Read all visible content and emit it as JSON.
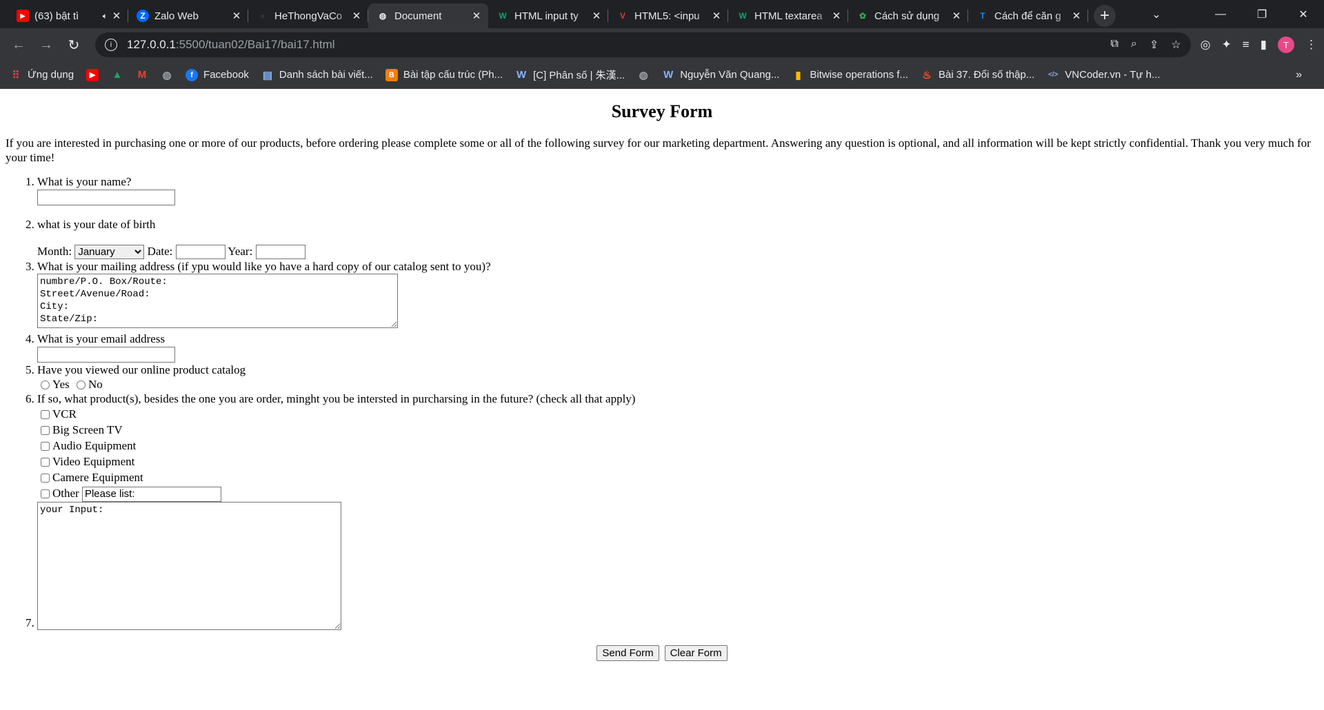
{
  "browser": {
    "tabs": [
      {
        "title": "(63) bật tì",
        "favicon": "youtube-icon",
        "color": "#ff0000",
        "audio": true,
        "active": false
      },
      {
        "title": "Zalo Web",
        "favicon": "zalo-icon",
        "color": "#0068ff",
        "active": false
      },
      {
        "title": "HeThongVaCo",
        "favicon": "github-icon",
        "color": "#333333",
        "active": false
      },
      {
        "title": "Document",
        "favicon": "globe-icon",
        "color": "#e8eaed",
        "active": true
      },
      {
        "title": "HTML input ty",
        "favicon": "w3schools-icon",
        "color": "#04aa6d",
        "active": false
      },
      {
        "title": "HTML5: <inpu",
        "favicon": "v1-icon",
        "color": "#e53935",
        "active": false
      },
      {
        "title": "HTML textarea",
        "favicon": "w3schools-icon",
        "color": "#04aa6d",
        "active": false
      },
      {
        "title": "Cách sử dụng",
        "favicon": "green-gear-icon",
        "color": "#34a853",
        "active": false
      },
      {
        "title": "Cách để căn g",
        "favicon": "blue-t-icon",
        "color": "#1e88e5",
        "active": false
      }
    ],
    "url_host": "127.0.0.1",
    "url_path": ":5500/tuan02/Bai17/bai17.html",
    "profile_initial": "T",
    "bookmarks": [
      {
        "label": "Ứng dụng",
        "icon": "apps-grid-icon",
        "color": "#e8453c"
      },
      {
        "label": "",
        "icon": "youtube-icon",
        "color": "#ff0000"
      },
      {
        "label": "",
        "icon": "drive-icon",
        "color": "#1fa463"
      },
      {
        "label": "",
        "icon": "gmail-icon",
        "color": "#ea4335"
      },
      {
        "label": "",
        "icon": "globe-icon",
        "color": "#9aa0a6"
      },
      {
        "label": "Facebook",
        "icon": "facebook-icon",
        "color": "#1877f2"
      },
      {
        "label": "Danh sách bài viết...",
        "icon": "document-icon",
        "color": "#8ab4f8"
      },
      {
        "label": "Bài tập cấu trúc (Ph...",
        "icon": "blogger-icon",
        "color": "#f57d00"
      },
      {
        "label": "[C] Phân số | 朱漢...",
        "icon": "wordpress-icon",
        "color": "#8ab4f8"
      },
      {
        "label": "",
        "icon": "globe-icon",
        "color": "#9aa0a6"
      },
      {
        "label": "Nguyễn Văn Quang...",
        "icon": "wordpress-icon",
        "color": "#8ab4f8"
      },
      {
        "label": "Bitwise operations f...",
        "icon": "bar-chart-icon",
        "color": "#fbbc04"
      },
      {
        "label": "Bài 37. Đổi số thập...",
        "icon": "fire-icon",
        "color": "#ff5722"
      },
      {
        "label": "VNCoder.vn - Tự h...",
        "icon": "code-icon",
        "color": "#8ab4f8"
      }
    ]
  },
  "page": {
    "title": "Survey Form",
    "intro": "If you are interested in purchasing one or more of our products, before ordering please complete some or all of the following survey for our marketing department. Answering any question is optional, and all information will be kept strictly confidential. Thank you very much for your time!",
    "q1": "What is your name?",
    "q2": "what is your date of birth",
    "month_label": "Month:",
    "month_selected": "January",
    "date_label": "Date:",
    "year_label": "Year:",
    "q3": "What is your mailing address (if ypu would like yo have a hard copy of our catalog sent to you)?",
    "address_text": "numbre/P.O. Box/Route:\nStreet/Avenue/Road:\nCity:\nState/Zip:",
    "q4": "What is your email address",
    "q5": "Have you viewed our online product catalog",
    "yes_label": "Yes",
    "no_label": "No",
    "q6": "If so, what product(s), besides the one you are order, minght you be intersted in purcharsing in the future? (check all that apply)",
    "products": [
      "VCR",
      "Big Screen TV",
      "Audio Equipment",
      "Video Equipment",
      "Camere Equipment"
    ],
    "other_label": "Other",
    "other_value": "Please list:",
    "comment_text": "your Input:",
    "send_label": "Send Form",
    "clear_label": "Clear Form"
  }
}
